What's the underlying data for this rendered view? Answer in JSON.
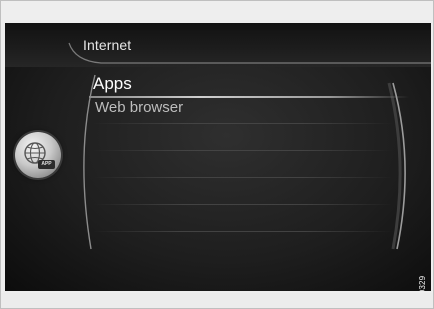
{
  "header": {
    "title": "Internet"
  },
  "menu": {
    "items": [
      {
        "label": "Apps",
        "selected": true
      },
      {
        "label": "Web browser",
        "selected": false
      }
    ]
  },
  "app_icon": {
    "icon": "globe-app-icon",
    "badge": "APP"
  },
  "image_code": "G050329",
  "colors": {
    "screen_bg": "#1e1e1e",
    "selected_text": "#ffffff",
    "item_text": "#bdbdbd",
    "header_text": "#e6e6e6"
  }
}
